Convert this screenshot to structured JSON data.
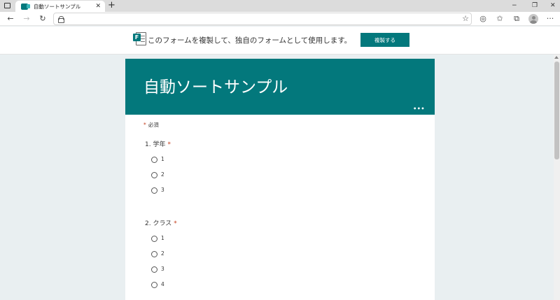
{
  "browser": {
    "tab_title": "自動ソートサンプル",
    "tab_close": "✕",
    "new_tab": "+",
    "window_controls": {
      "minimize": "−",
      "restore": "❐",
      "close": "✕"
    },
    "toolbar_icons": [
      "back-arrow-icon",
      "forward-arrow-icon",
      "refresh-icon",
      "lock-icon",
      "favorites-add-icon",
      "edge-icon",
      "favorites-icon",
      "collections-icon",
      "profile-icon",
      "more-icon"
    ],
    "glyphs": {
      "back": "←",
      "forward": "→",
      "refresh": "↻",
      "fav_add": "☆",
      "edge": "◎",
      "favorites": "✩",
      "collections": "⧉",
      "more": "···"
    }
  },
  "banner": {
    "message": "このフォームを複製して、独自のフォームとして使用します。",
    "duplicate_button": "複製する",
    "icon_letter": "F"
  },
  "form": {
    "title": "自動ソートサンプル",
    "more_dots": "•••",
    "required_star": "*",
    "required_note": "必須",
    "questions": [
      {
        "label": "1. 学年",
        "required_mark": "*",
        "options": [
          "1",
          "2",
          "3"
        ]
      },
      {
        "label": "2. クラス",
        "required_mark": "*",
        "options": [
          "1",
          "2",
          "3",
          "4"
        ]
      }
    ]
  },
  "colors": {
    "accent": "#03787c",
    "required": "#c43e1c",
    "page_bg": "#e9eff1"
  }
}
